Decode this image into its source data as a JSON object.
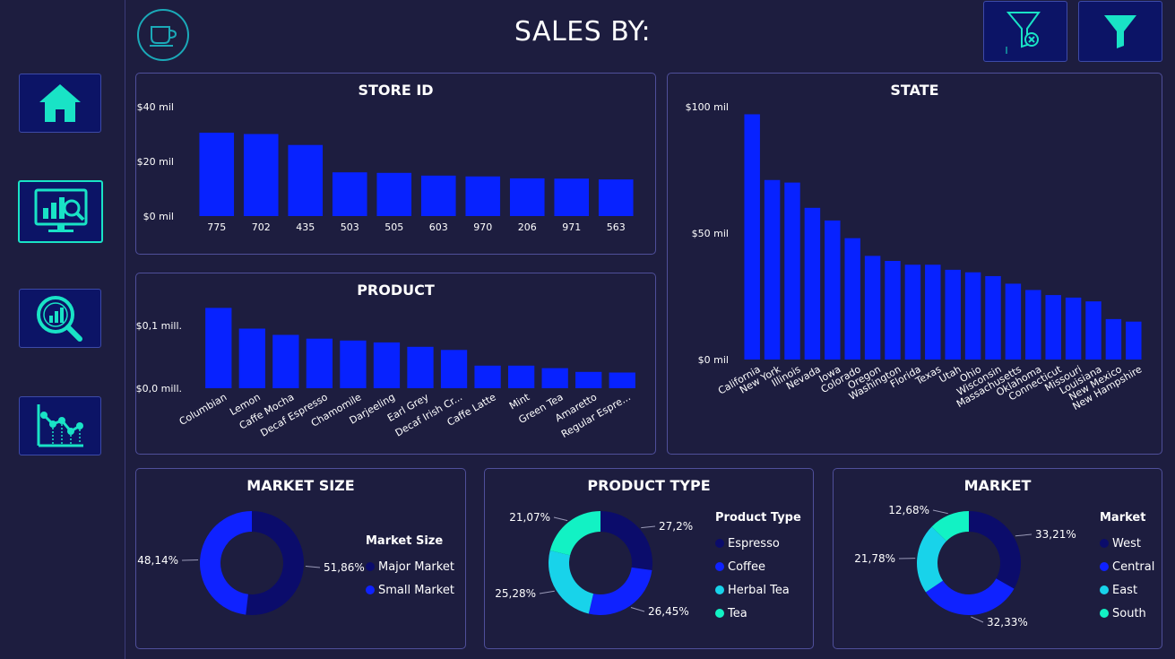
{
  "header": {
    "title": "SALES BY:"
  },
  "toolbar": {
    "logo_icon": "coffee-cup-icon",
    "clear_filter_icon": "clear-filter-icon",
    "filter_icon": "filter-icon"
  },
  "nav": [
    {
      "icon": "home-icon",
      "active": false
    },
    {
      "icon": "monitor-chart-icon",
      "active": true
    },
    {
      "icon": "magnifier-chart-icon",
      "active": false
    },
    {
      "icon": "line-chart-icon",
      "active": false
    }
  ],
  "colors": {
    "bar": "#0722ff",
    "accent": "#19e3c6",
    "bg": "#1d1d3f",
    "navy": "#0b0c6b",
    "blue": "#0f22ff",
    "cyan": "#18d3ea",
    "teal": "#12f2c4"
  },
  "panels": {
    "store": {
      "title": "STORE ID"
    },
    "product": {
      "title": "PRODUCT"
    },
    "state": {
      "title": "STATE"
    },
    "market_size": {
      "title": "MARKET SIZE"
    },
    "product_type": {
      "title": "PRODUCT TYPE"
    },
    "market": {
      "title": "MARKET"
    }
  },
  "chart_data": [
    {
      "id": "store",
      "type": "bar",
      "title": "STORE ID",
      "categories": [
        "775",
        "702",
        "435",
        "503",
        "505",
        "603",
        "970",
        "206",
        "971",
        "563"
      ],
      "values": [
        30.5,
        30,
        26,
        16,
        15.8,
        14.8,
        14.5,
        13.8,
        13.7,
        13.4
      ],
      "ytick_values": [
        0,
        20,
        40
      ],
      "ytick_labels": [
        "$0 mil",
        "$20 mil",
        "$40 mil"
      ],
      "ylim": [
        0,
        40
      ],
      "unit": "$ mil"
    },
    {
      "id": "product",
      "type": "bar",
      "title": "PRODUCT",
      "categories": [
        "Columbian",
        "Lemon",
        "Caffe Mocha",
        "Decaf Espresso",
        "Chamomile",
        "Darjeeling",
        "Earl Grey",
        "Decaf Irish Cr...",
        "Caffe Latte",
        "Mint",
        "Green Tea",
        "Amaretto",
        "Regular Espre..."
      ],
      "values": [
        0.128,
        0.095,
        0.085,
        0.079,
        0.076,
        0.073,
        0.066,
        0.061,
        0.036,
        0.036,
        0.032,
        0.026,
        0.025
      ],
      "ytick_values": [
        0,
        0.1
      ],
      "ytick_labels": [
        "$0,0 mill.",
        "$0,1 mill."
      ],
      "ylim": [
        0,
        0.13
      ],
      "unit": "$ mill."
    },
    {
      "id": "state",
      "type": "bar",
      "title": "STATE",
      "categories": [
        "California",
        "New York",
        "Illinois",
        "Nevada",
        "Iowa",
        "Colorado",
        "Oregon",
        "Washington",
        "Florida",
        "Texas",
        "Utah",
        "Ohio",
        "Wisconsin",
        "Massachusetts",
        "Oklahoma",
        "Connecticut",
        "Missouri",
        "Louisiana",
        "New Mexico",
        "New Hampshire"
      ],
      "values": [
        97,
        71,
        70,
        60,
        55,
        48,
        41,
        39,
        37.5,
        37.5,
        35.5,
        34.5,
        33,
        30,
        27.5,
        25.5,
        24.5,
        23,
        16,
        15
      ],
      "ytick_values": [
        0,
        50,
        100
      ],
      "ytick_labels": [
        "$0 mil",
        "$50 mil",
        "$100 mil"
      ],
      "ylim": [
        0,
        100
      ],
      "unit": "$ mil"
    },
    {
      "id": "market_size",
      "type": "pie",
      "title": "MARKET SIZE",
      "legend_title": "Market Size",
      "labels": [
        "Major Market",
        "Small Market"
      ],
      "values": [
        51.86,
        48.14
      ],
      "value_labels": [
        "51,86%",
        "48,14%"
      ],
      "colors": [
        "#0b0c6b",
        "#0f22ff"
      ]
    },
    {
      "id": "product_type",
      "type": "pie",
      "title": "PRODUCT TYPE",
      "legend_title": "Product Type",
      "labels": [
        "Espresso",
        "Coffee",
        "Herbal Tea",
        "Tea"
      ],
      "values": [
        27.2,
        26.45,
        25.28,
        21.07
      ],
      "value_labels": [
        "27,2%",
        "26,45%",
        "25,28%",
        "21,07%"
      ],
      "colors": [
        "#0b0c6b",
        "#0f22ff",
        "#18d3ea",
        "#12f2c4"
      ]
    },
    {
      "id": "market",
      "type": "pie",
      "title": "MARKET",
      "legend_title": "Market",
      "labels": [
        "West",
        "Central",
        "East",
        "South"
      ],
      "values": [
        33.21,
        32.33,
        21.78,
        12.68
      ],
      "value_labels": [
        "33,21%",
        "32,33%",
        "21,78%",
        "12,68%"
      ],
      "colors": [
        "#0b0c6b",
        "#0f22ff",
        "#18d3ea",
        "#12f2c4"
      ]
    }
  ]
}
